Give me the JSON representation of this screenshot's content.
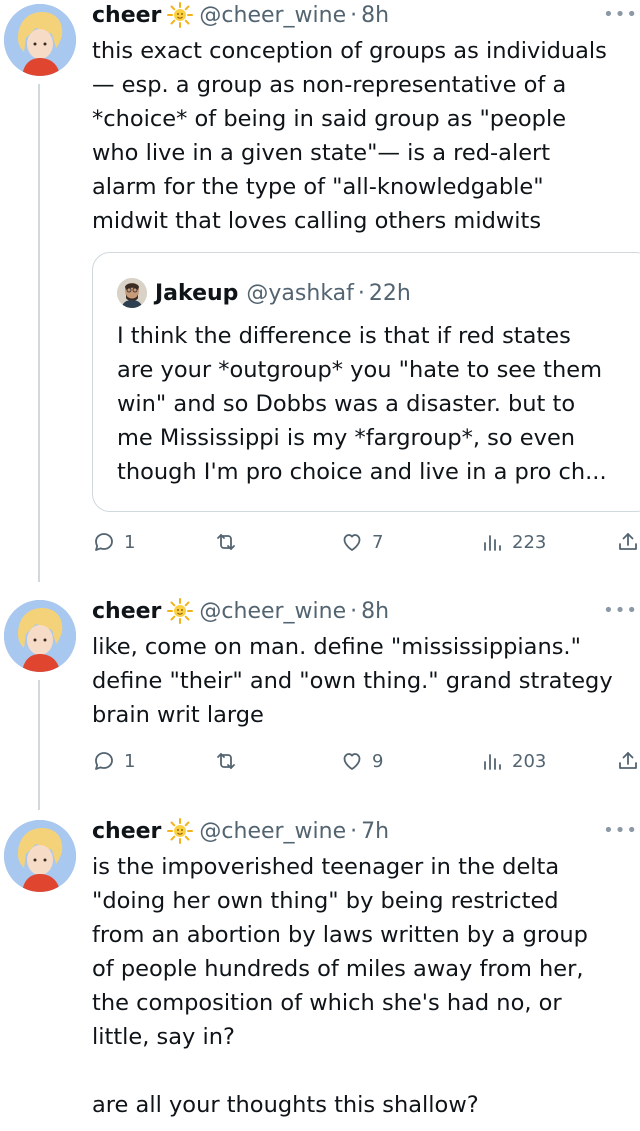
{
  "tweets": [
    {
      "name": "cheer",
      "emoji": "sun-emoji",
      "handle": "@cheer_wine",
      "time": "8h",
      "separator": "·",
      "text": "this exact conception of groups as individuals\n— esp. a group as non-representative of a\n*choice* of being in said group as \"people\nwho live in a given state\"— is a red-alert\nalarm for the type of \"all-knowledgable\"\nmidwit that loves calling others midwits",
      "quote": {
        "name": "Jakeup",
        "handle": "@yashkaf",
        "time": "22h",
        "text": "I think the difference is that if red states\nare your *outgroup* you \"hate to see them\nwin\" and so Dobbs was a disaster. but to\nme Mississippi is my *fargroup*, so even\nthough I'm pro choice and live in a pro ch..."
      },
      "actions": {
        "replies": "1",
        "reposts": "",
        "likes": "7",
        "views": "223"
      }
    },
    {
      "name": "cheer",
      "emoji": "sun-emoji",
      "handle": "@cheer_wine",
      "time": "8h",
      "separator": "·",
      "text": "like, come on man. define \"mississippians.\"\ndefine \"their\" and \"own thing.\" grand strategy\nbrain writ large",
      "actions": {
        "replies": "1",
        "reposts": "",
        "likes": "9",
        "views": "203"
      }
    },
    {
      "name": "cheer",
      "emoji": "sun-emoji",
      "handle": "@cheer_wine",
      "time": "7h",
      "separator": "·",
      "text": "is the impoverished teenager in the delta\n\"doing her own thing\" by being restricted\nfrom an abortion by laws written by a group\nof people hundreds of miles away from her,\nthe composition of which she's had no, or\nlittle, say in?\n\nare all your thoughts this shallow?"
    }
  ],
  "more_label": "•••",
  "colors": {
    "text": "#0f1419",
    "secondary": "#536471",
    "border": "#cfd9de"
  }
}
